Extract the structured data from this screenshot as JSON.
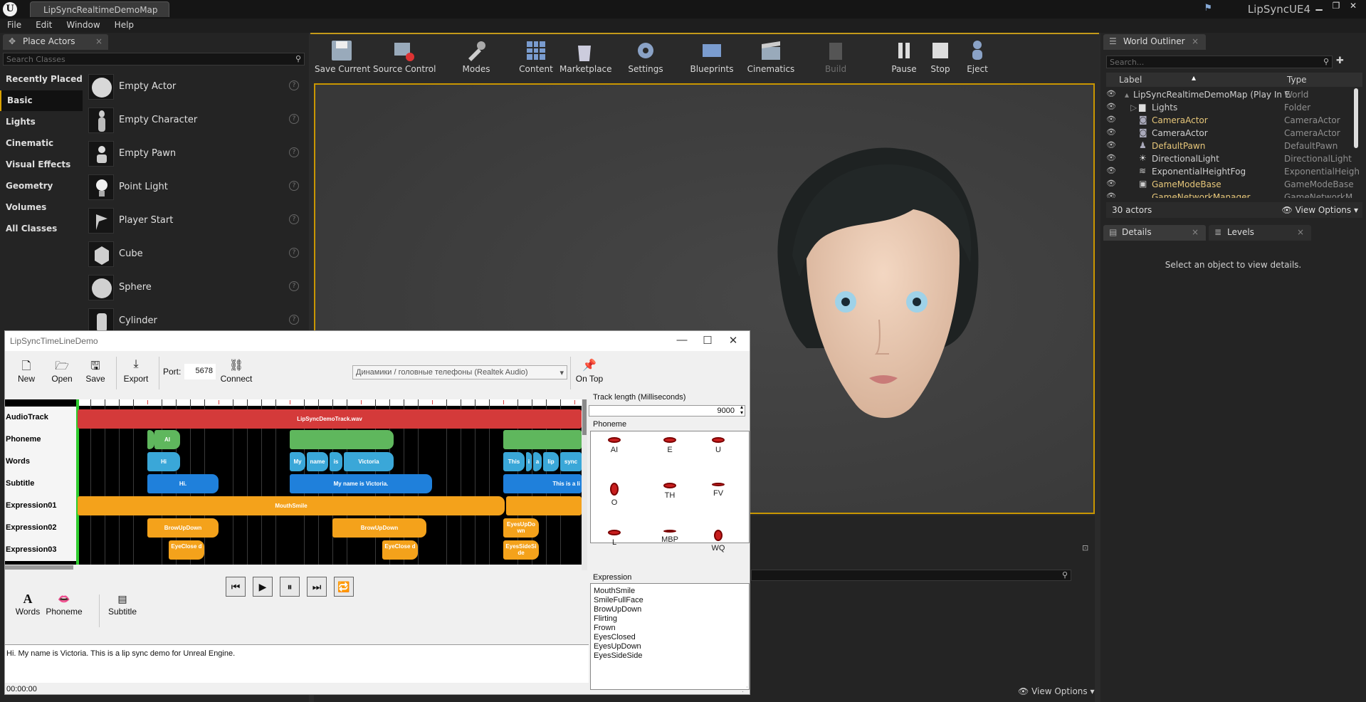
{
  "ue": {
    "doc_tab": "LipSyncRealtimeDemoMap",
    "app_title": "LipSyncUE4",
    "menu": [
      "File",
      "Edit",
      "Window",
      "Help"
    ]
  },
  "place_actors": {
    "tab_label": "Place Actors",
    "search_placeholder": "Search Classes",
    "categories": [
      "Recently Placed",
      "Basic",
      "Lights",
      "Cinematic",
      "Visual Effects",
      "Geometry",
      "Volumes",
      "All Classes"
    ],
    "active_category": "Basic",
    "items": [
      "Empty Actor",
      "Empty Character",
      "Empty Pawn",
      "Point Light",
      "Player Start",
      "Cube",
      "Sphere",
      "Cylinder"
    ]
  },
  "toolbar": {
    "buttons": [
      "Save Current",
      "Source Control",
      "Modes",
      "Content",
      "Marketplace",
      "Settings",
      "Blueprints",
      "Cinematics",
      "Build",
      "Pause",
      "Stop",
      "Eject"
    ]
  },
  "world_outliner": {
    "tab_label": "World Outliner",
    "search_placeholder": "Search...",
    "col_label": "Label",
    "col_type": "Type",
    "rows": [
      {
        "label": "LipSyncRealtimeDemoMap (Play In E",
        "type": "World",
        "color": "#8a8a8a"
      },
      {
        "label": "Lights",
        "type": "Folder",
        "color": "#d6d6d6"
      },
      {
        "label": "CameraActor",
        "type": "CameraActor",
        "color": "#e7c77a"
      },
      {
        "label": "CameraActor",
        "type": "CameraActor",
        "color": "#d6d6d6"
      },
      {
        "label": "DefaultPawn",
        "type": "DefaultPawn",
        "color": "#e7c77a"
      },
      {
        "label": "DirectionalLight",
        "type": "DirectionalLight",
        "color": "#d6d6d6"
      },
      {
        "label": "ExponentialHeightFog",
        "type": "ExponentialHeigh",
        "color": "#d6d6d6"
      },
      {
        "label": "GameModeBase",
        "type": "GameModeBase",
        "color": "#e7c77a"
      },
      {
        "label": "GameNetworkManager",
        "type": "GameNetworkMa",
        "color": "#e7c77a"
      }
    ],
    "actor_count": "30 actors",
    "view_options": "View Options"
  },
  "details": {
    "tab_details": "Details",
    "tab_levels": "Levels",
    "empty_message": "Select an object to view details."
  },
  "viewport_bottom": {
    "view_options": "View Options"
  },
  "dialog": {
    "title": "LipSyncTimeLineDemo",
    "buttons": {
      "new": "New",
      "open": "Open",
      "save": "Save",
      "export": "Export",
      "connect": "Connect",
      "on_top": "On Top"
    },
    "port_label": "Port:",
    "port_value": "5678",
    "audio_device": "Динамики / головные телефоны (Realtek Audio)",
    "tracks": [
      "AudioTrack",
      "Phoneme",
      "Words",
      "Subtitle",
      "Expression01",
      "Expression02",
      "Expression03"
    ],
    "audio_clip": "LipSyncDemoTrack.wav",
    "words": [
      "Hi",
      "My",
      "name",
      "is",
      "Victoria",
      "This",
      "i",
      "a",
      "lip",
      "sync"
    ],
    "subtitles": [
      "Hi.",
      "My name is Victoria.",
      "This is a li"
    ],
    "expression01": "MouthSmile",
    "expression02": [
      "BrowUpDown",
      "BrowUpDown",
      "EyesUpDo wn"
    ],
    "expression03": [
      "EyeClose d",
      "EyeClose d",
      "EyesSideSi de"
    ],
    "track_length_label": "Track length (Milliseconds)",
    "track_length_value": "9000",
    "phoneme_label": "Phoneme",
    "phonemes": [
      "AI",
      "E",
      "U",
      "O",
      "TH",
      "FV",
      "L",
      "MBP",
      "WQ"
    ],
    "expression_label": "Expression",
    "expressions": [
      "MouthSmile",
      "SmileFullFace",
      "BrowUpDown",
      "Flirting",
      "Frown",
      "EyesClosed",
      "EyesUpDown",
      "EyesSideSide"
    ],
    "bottom_buttons": {
      "words": "Words",
      "phoneme": "Phoneme",
      "subtitle": "Subtitle"
    },
    "text": "Hi. My name is Victoria. This is a lip sync demo for Unreal Engine.",
    "time": "00:00:00"
  }
}
